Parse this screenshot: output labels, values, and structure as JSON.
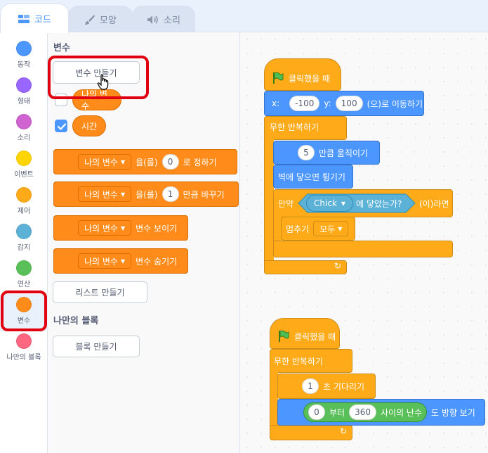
{
  "tabs": [
    {
      "label": "코드",
      "icon": "code-icon",
      "active": true
    },
    {
      "label": "모양",
      "icon": "brush-icon",
      "active": false
    },
    {
      "label": "소리",
      "icon": "speaker-icon",
      "active": false
    }
  ],
  "categories": [
    {
      "label": "동작",
      "color": "#4c97ff"
    },
    {
      "label": "형태",
      "color": "#9966ff"
    },
    {
      "label": "소리",
      "color": "#cf63cf"
    },
    {
      "label": "이벤트",
      "color": "#ffd500"
    },
    {
      "label": "제어",
      "color": "#ffab19"
    },
    {
      "label": "감지",
      "color": "#5cb1d6"
    },
    {
      "label": "연산",
      "color": "#59c059"
    },
    {
      "label": "변수",
      "color": "#ff8c1a",
      "selected": true
    },
    {
      "label": "나만의 블록",
      "color": "#ff6680"
    }
  ],
  "palette": {
    "variables_title": "변수",
    "make_variable": "변수 만들기",
    "my_variable_reporter": "나의 변수",
    "timer_reporter": "시간",
    "set_block": {
      "var": "나의 변수",
      "text1": "을(를)",
      "value": "0",
      "text2": "로 정하기"
    },
    "change_block": {
      "var": "나의 변수",
      "text1": "을(를)",
      "value": "1",
      "text2": "만큼 바꾸기"
    },
    "show_block": {
      "var": "나의 변수",
      "text": "변수 보이기"
    },
    "hide_block": {
      "var": "나의 변수",
      "text": "변수 숨기기"
    },
    "make_list": "리스트 만들기",
    "my_blocks_title": "나만의 블록",
    "make_block": "블록 만들기"
  },
  "script1": {
    "hat": "클릭했을 때",
    "goto": {
      "x_label": "x:",
      "x": "-100",
      "y_label": "y:",
      "y": "100",
      "suffix": "(으)로 이동하기"
    },
    "forever": "무한 반복하기",
    "move": {
      "value": "5",
      "text": "만큼 움직이기"
    },
    "bounce": "벽에 닿으면 튕기기",
    "if": {
      "prefix": "만약",
      "touch_target": "Chick",
      "touch_text": "에 닿았는가?",
      "suffix": "(이)라면"
    },
    "stop": {
      "text": "멈추기",
      "option": "모두"
    }
  },
  "script2": {
    "hat": "클릭했을 때",
    "forever": "무한 반복하기",
    "wait": {
      "value": "1",
      "text": "초 기다리기"
    },
    "point": {
      "from_value": "0",
      "from_text": "부터",
      "to_value": "360",
      "random_text": "사이의 난수",
      "suffix": "도 방향 보기"
    }
  },
  "colors": {
    "motion": "#4c97ff",
    "control": "#ffab19",
    "events": "#ffbf00",
    "variables": "#ff8c1a",
    "sensing": "#5cb1d6",
    "operators": "#59c059",
    "highlight": "#e00010"
  }
}
